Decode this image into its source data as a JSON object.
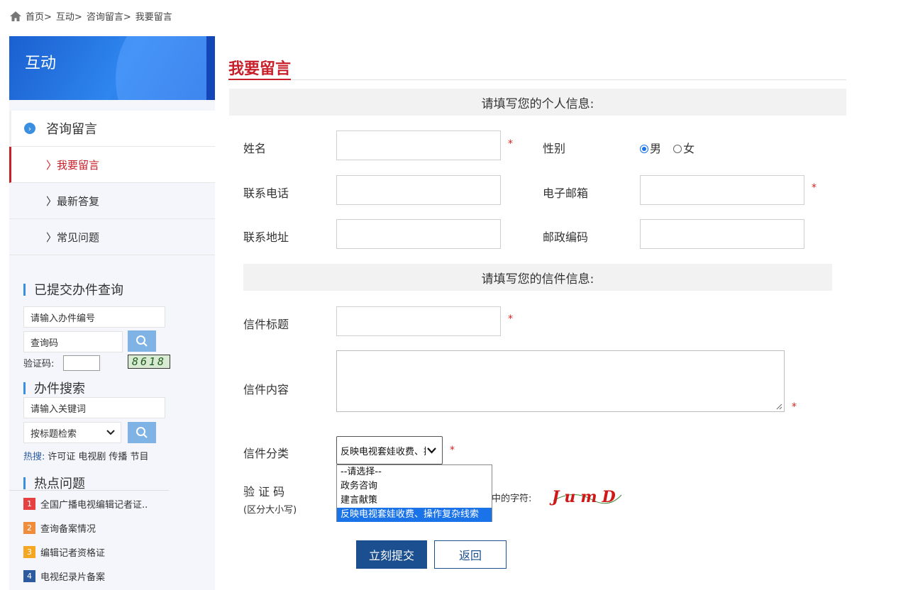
{
  "breadcrumb": {
    "items": [
      "首页>",
      "互动>",
      "咨询留言>",
      "我要留言"
    ]
  },
  "sidebar": {
    "banner_title": "互动",
    "nav_header": "咨询留言",
    "nav_items": [
      {
        "label": "我要留言"
      },
      {
        "label": "最新答复"
      },
      {
        "label": "常见问题"
      }
    ],
    "query": {
      "title": "已提交办件查询",
      "number_placeholder": "请输入办件编号",
      "code_placeholder": "查询码",
      "captcha_label": "验证码:",
      "captcha_value": "8618"
    },
    "search": {
      "title": "办件搜索",
      "keyword_placeholder": "请输入关键词",
      "mode_selected": "按标题检索",
      "hot_label": "热搜:",
      "hot_words": [
        "许可证",
        "电视剧",
        "传播",
        "节目"
      ]
    },
    "hot": {
      "title": "热点问题",
      "items": [
        {
          "num": "1",
          "text": "全国广播电视编辑记者证..",
          "color": "#e64040"
        },
        {
          "num": "2",
          "text": "查询备案情况",
          "color": "#f08c3a"
        },
        {
          "num": "3",
          "text": "编辑记者资格证",
          "color": "#f5a623"
        },
        {
          "num": "4",
          "text": "电视纪录片备案",
          "color": "#2c5aa0"
        }
      ]
    }
  },
  "main": {
    "page_title": "我要留言",
    "personal_section": "请填写您的个人信息:",
    "name_label": "姓名",
    "gender_label": "性别",
    "gender_male": "男",
    "gender_female": "女",
    "phone_label": "联系电话",
    "email_label": "电子邮箱",
    "address_label": "联系地址",
    "postcode_label": "邮政编码",
    "letter_section": "请填写您的信件信息:",
    "subject_label": "信件标题",
    "content_label": "信件内容",
    "category_label": "信件分类",
    "category_selected": "反映电视套娃收费、操作复杂线索",
    "category_options": [
      "--请选择--",
      "政务咨询",
      "建言献策",
      "反映电视套娃收费、操作复杂线索"
    ],
    "captcha_label": "验 证 码",
    "captcha_sub": "(区分大小写)",
    "captcha_hint": "图中的字符:",
    "captcha_text": "JumD",
    "required_mark": "*",
    "submit_label": "立刻提交",
    "back_label": "返回"
  },
  "colors": {
    "accent_red": "#c8202a",
    "primary_blue": "#1b4f8f",
    "search_blue": "#7fb3e6"
  }
}
